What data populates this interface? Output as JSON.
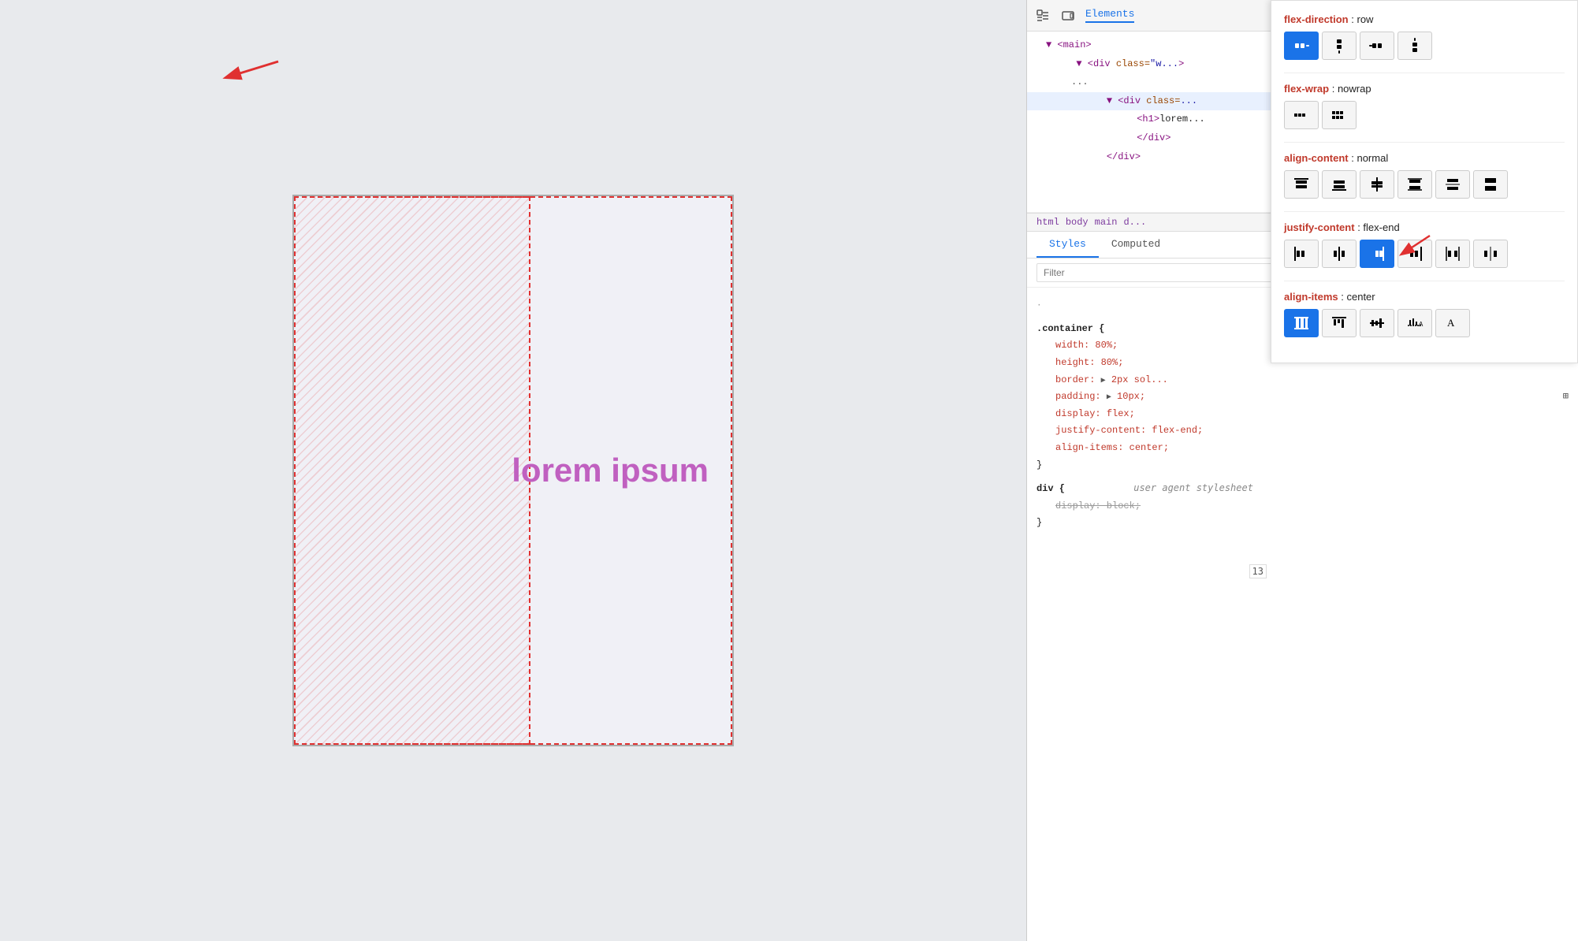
{
  "preview": {
    "lorem_text": "lorem ipsum"
  },
  "devtools": {
    "toolbar": {
      "inspect_icon": "⬚",
      "device_icon": "▭",
      "tab_label": "Elements"
    },
    "dom": {
      "lines": [
        {
          "indent": 1,
          "content": "▼ <main>"
        },
        {
          "indent": 2,
          "content": "▼ <div class=\"w..."
        },
        {
          "indent": 2,
          "content": "..."
        },
        {
          "indent": 3,
          "content": "▼ <div class=..."
        },
        {
          "indent": 4,
          "content": "<h1>lorem..."
        },
        {
          "indent": 4,
          "content": "</div>"
        },
        {
          "indent": 3,
          "content": "</div>"
        }
      ]
    },
    "breadcrumb": {
      "items": [
        "html",
        "body",
        "main",
        "d..."
      ]
    },
    "tabs": {
      "styles_label": "Styles",
      "computed_label": "Computed"
    },
    "filter": {
      "placeholder": "Filter"
    },
    "css_rules": {
      "container_rule": {
        "selector": ".container {",
        "properties": [
          {
            "prop": "width:",
            "value": "80%;"
          },
          {
            "prop": "height:",
            "value": "80%;"
          },
          {
            "prop": "border:",
            "value": "▶ 2px sol..."
          },
          {
            "prop": "padding:",
            "value": "▶ 10px;"
          },
          {
            "prop": "display:",
            "value": "flex;"
          },
          {
            "prop": "justify-content:",
            "value": "flex-end;"
          },
          {
            "prop": "align-items:",
            "value": "center;"
          }
        ],
        "close": "}"
      },
      "div_rule": {
        "selector": "div {",
        "comment": "user agent stylesheet",
        "properties": [
          {
            "prop": "display: block;",
            "strikethrough": true
          }
        ],
        "close": "}"
      }
    }
  },
  "flex_inspector": {
    "flex_direction": {
      "label": "flex-direction",
      "value": "row",
      "buttons": [
        "row",
        "col-down",
        "row-rev",
        "col-up"
      ]
    },
    "flex_wrap": {
      "label": "flex-wrap",
      "value": "nowrap",
      "buttons": [
        "nowrap",
        "wrap"
      ]
    },
    "align_content": {
      "label": "align-content",
      "value": "normal",
      "buttons": [
        "start",
        "end",
        "center",
        "space-between",
        "space-around",
        "stretch"
      ]
    },
    "justify_content": {
      "label": "justify-content",
      "value": "flex-end",
      "buttons": [
        "flex-start",
        "center",
        "flex-end-left",
        "flex-end",
        "space-between",
        "space-around"
      ]
    },
    "align_items": {
      "label": "align-items",
      "value": "center",
      "buttons": [
        "stretch",
        "top",
        "center",
        "baseline",
        "text"
      ]
    }
  }
}
